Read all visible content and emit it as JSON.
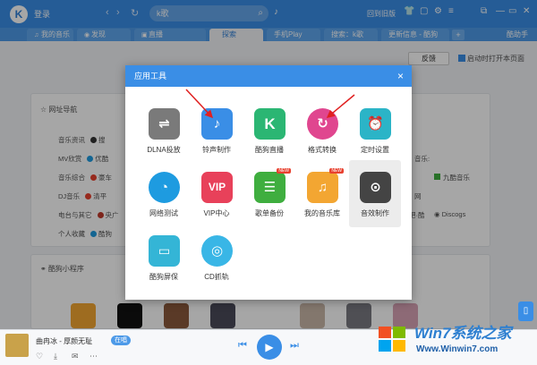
{
  "topbar": {
    "logo": "K",
    "login": "登录",
    "search_value": "k歌",
    "old_version": "回到旧版",
    "accent": "#3a8ee6"
  },
  "tabs": [
    {
      "label": "我的音乐",
      "icon": "music-note-icon"
    },
    {
      "label": "发现",
      "icon": "compass-icon"
    },
    {
      "label": "直播",
      "icon": "live-icon"
    },
    {
      "label": "探索",
      "icon": "",
      "active": true
    },
    {
      "label": "手机Play",
      "icon": ""
    },
    {
      "label": "搜索：k歌",
      "icon": ""
    },
    {
      "label": "更新信息 - 酷狗",
      "icon": ""
    }
  ],
  "tab_extra": {
    "add": "+",
    "assistant": "酷助手"
  },
  "page": {
    "feedback": "反馈",
    "startup_checkbox": "启动时打开本页面",
    "nav_title": "网址导航",
    "nav_rows": [
      {
        "label": "音乐资讯",
        "item": "搜"
      },
      {
        "label": "MV欣赏",
        "item": "优酷"
      },
      {
        "label": "音乐综合",
        "item": "豪车"
      },
      {
        "label": "DJ音乐",
        "item": "清平"
      },
      {
        "label": "电台与其它",
        "item": "央广"
      },
      {
        "label": "个人收藏",
        "item": "酷狗"
      }
    ],
    "nav_right": [
      "音乐:",
      "九酷音乐",
      "网",
      "吧·酷",
      "Discogs"
    ],
    "mini_title": "酷狗小程序"
  },
  "dialog": {
    "title": "应用工具",
    "close": "×",
    "tools": [
      {
        "label": "DLNA投放",
        "icon": "dlna-cast-icon",
        "color": "#7a7a7a"
      },
      {
        "label": "铃声制作",
        "icon": "ringtone-phone-icon",
        "color": "#3a8ee6"
      },
      {
        "label": "酷狗直播",
        "icon": "kugou-live-icon",
        "color": "#2bb673"
      },
      {
        "label": "格式转换",
        "icon": "format-convert-icon",
        "color": "#e0468f"
      },
      {
        "label": "定时设置",
        "icon": "alarm-clock-icon",
        "color": "#2bb4c7"
      },
      {
        "label": "网络测试",
        "icon": "speed-gauge-icon",
        "color": "#1e9be0"
      },
      {
        "label": "VIP中心",
        "icon": "vip-crown-icon",
        "color": "#e8415a"
      },
      {
        "label": "歌单备份",
        "icon": "playlist-backup-icon",
        "color": "#3fae3f",
        "new": "NEW"
      },
      {
        "label": "我的音乐库",
        "icon": "music-library-icon",
        "color": "#f3a632",
        "new": "NEW"
      },
      {
        "label": "音效制作",
        "icon": "sound-effect-icon",
        "color": "#444444"
      },
      {
        "label": "酷狗屏保",
        "icon": "screensaver-icon",
        "color": "#34b5d6"
      },
      {
        "label": "CD抓轨",
        "icon": "cd-rip-icon",
        "color": "#39b6e6"
      }
    ]
  },
  "player": {
    "song": "曲冉冰 - 厚颜无耻",
    "badge": "在唱",
    "prev": "⏮",
    "play": "▶",
    "next": "⏭"
  },
  "watermark": {
    "line1": "Win7系统之家",
    "line2": "Www.Winwin7.com"
  }
}
